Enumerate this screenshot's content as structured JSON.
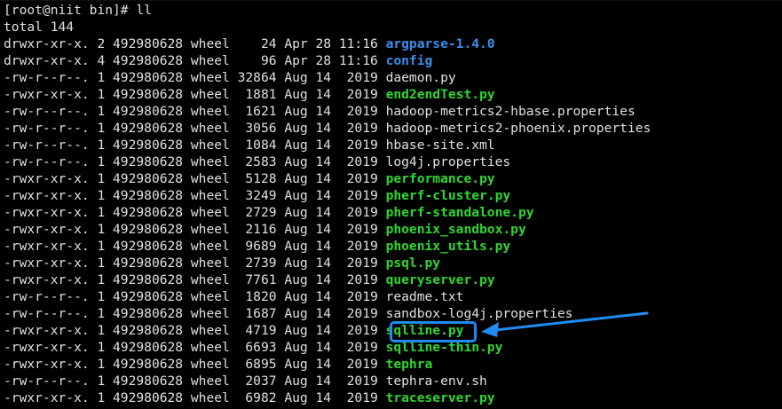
{
  "prompt": "[root@niit bin]# ll",
  "total": "total 144",
  "entries": [
    {
      "perm": "drwxr-xr-x.",
      "links": "2",
      "owner": "492980628",
      "group": "wheel",
      "size": "24",
      "month": "Apr",
      "day": "28",
      "time": "11:16",
      "name": "argparse-1.4.0",
      "kind": "dir"
    },
    {
      "perm": "drwxr-xr-x.",
      "links": "4",
      "owner": "492980628",
      "group": "wheel",
      "size": "96",
      "month": "Apr",
      "day": "28",
      "time": "11:16",
      "name": "config",
      "kind": "dir"
    },
    {
      "perm": "-rw-r--r--.",
      "links": "1",
      "owner": "492980628",
      "group": "wheel",
      "size": "32864",
      "month": "Aug",
      "day": "14",
      "time": "2019",
      "name": "daemon.py",
      "kind": "plain"
    },
    {
      "perm": "-rwxr-xr-x.",
      "links": "1",
      "owner": "492980628",
      "group": "wheel",
      "size": "1881",
      "month": "Aug",
      "day": "14",
      "time": "2019",
      "name": "end2endTest.py",
      "kind": "exec"
    },
    {
      "perm": "-rw-r--r--.",
      "links": "1",
      "owner": "492980628",
      "group": "wheel",
      "size": "1621",
      "month": "Aug",
      "day": "14",
      "time": "2019",
      "name": "hadoop-metrics2-hbase.properties",
      "kind": "plain"
    },
    {
      "perm": "-rw-r--r--.",
      "links": "1",
      "owner": "492980628",
      "group": "wheel",
      "size": "3056",
      "month": "Aug",
      "day": "14",
      "time": "2019",
      "name": "hadoop-metrics2-phoenix.properties",
      "kind": "plain"
    },
    {
      "perm": "-rw-r--r--.",
      "links": "1",
      "owner": "492980628",
      "group": "wheel",
      "size": "1084",
      "month": "Aug",
      "day": "14",
      "time": "2019",
      "name": "hbase-site.xml",
      "kind": "plain"
    },
    {
      "perm": "-rw-r--r--.",
      "links": "1",
      "owner": "492980628",
      "group": "wheel",
      "size": "2583",
      "month": "Aug",
      "day": "14",
      "time": "2019",
      "name": "log4j.properties",
      "kind": "plain"
    },
    {
      "perm": "-rwxr-xr-x.",
      "links": "1",
      "owner": "492980628",
      "group": "wheel",
      "size": "5128",
      "month": "Aug",
      "day": "14",
      "time": "2019",
      "name": "performance.py",
      "kind": "exec"
    },
    {
      "perm": "-rwxr-xr-x.",
      "links": "1",
      "owner": "492980628",
      "group": "wheel",
      "size": "3249",
      "month": "Aug",
      "day": "14",
      "time": "2019",
      "name": "pherf-cluster.py",
      "kind": "exec"
    },
    {
      "perm": "-rwxr-xr-x.",
      "links": "1",
      "owner": "492980628",
      "group": "wheel",
      "size": "2729",
      "month": "Aug",
      "day": "14",
      "time": "2019",
      "name": "pherf-standalone.py",
      "kind": "exec"
    },
    {
      "perm": "-rwxr-xr-x.",
      "links": "1",
      "owner": "492980628",
      "group": "wheel",
      "size": "2116",
      "month": "Aug",
      "day": "14",
      "time": "2019",
      "name": "phoenix_sandbox.py",
      "kind": "exec"
    },
    {
      "perm": "-rwxr-xr-x.",
      "links": "1",
      "owner": "492980628",
      "group": "wheel",
      "size": "9689",
      "month": "Aug",
      "day": "14",
      "time": "2019",
      "name": "phoenix_utils.py",
      "kind": "exec"
    },
    {
      "perm": "-rwxr-xr-x.",
      "links": "1",
      "owner": "492980628",
      "group": "wheel",
      "size": "2739",
      "month": "Aug",
      "day": "14",
      "time": "2019",
      "name": "psql.py",
      "kind": "exec"
    },
    {
      "perm": "-rwxr-xr-x.",
      "links": "1",
      "owner": "492980628",
      "group": "wheel",
      "size": "7761",
      "month": "Aug",
      "day": "14",
      "time": "2019",
      "name": "queryserver.py",
      "kind": "exec"
    },
    {
      "perm": "-rw-r--r--.",
      "links": "1",
      "owner": "492980628",
      "group": "wheel",
      "size": "1820",
      "month": "Aug",
      "day": "14",
      "time": "2019",
      "name": "readme.txt",
      "kind": "plain"
    },
    {
      "perm": "-rw-r--r--.",
      "links": "1",
      "owner": "492980628",
      "group": "wheel",
      "size": "1687",
      "month": "Aug",
      "day": "14",
      "time": "2019",
      "name": "sandbox-log4j.properties",
      "kind": "plain"
    },
    {
      "perm": "-rwxr-xr-x.",
      "links": "1",
      "owner": "492980628",
      "group": "wheel",
      "size": "4719",
      "month": "Aug",
      "day": "14",
      "time": "2019",
      "name": "sqlline.py",
      "kind": "exec"
    },
    {
      "perm": "-rwxr-xr-x.",
      "links": "1",
      "owner": "492980628",
      "group": "wheel",
      "size": "6693",
      "month": "Aug",
      "day": "14",
      "time": "2019",
      "name": "sqlline-thin.py",
      "kind": "exec"
    },
    {
      "perm": "-rwxr-xr-x.",
      "links": "1",
      "owner": "492980628",
      "group": "wheel",
      "size": "6895",
      "month": "Aug",
      "day": "14",
      "time": "2019",
      "name": "tephra",
      "kind": "exec"
    },
    {
      "perm": "-rw-r--r--.",
      "links": "1",
      "owner": "492980628",
      "group": "wheel",
      "size": "2037",
      "month": "Aug",
      "day": "14",
      "time": "2019",
      "name": "tephra-env.sh",
      "kind": "plain"
    },
    {
      "perm": "-rwxr-xr-x.",
      "links": "1",
      "owner": "492980628",
      "group": "wheel",
      "size": "6982",
      "month": "Aug",
      "day": "14",
      "time": "2019",
      "name": "traceserver.py",
      "kind": "exec"
    }
  ],
  "colors": {
    "background": "#000000",
    "text": "#e0e0e0",
    "directory": "#3b8eea",
    "executable": "#2fd72f",
    "annotation": "#1f8bf0"
  },
  "annotation": {
    "highlighted_entry": "sqlline.py",
    "arrow_icon": "arrow-left-icon"
  }
}
